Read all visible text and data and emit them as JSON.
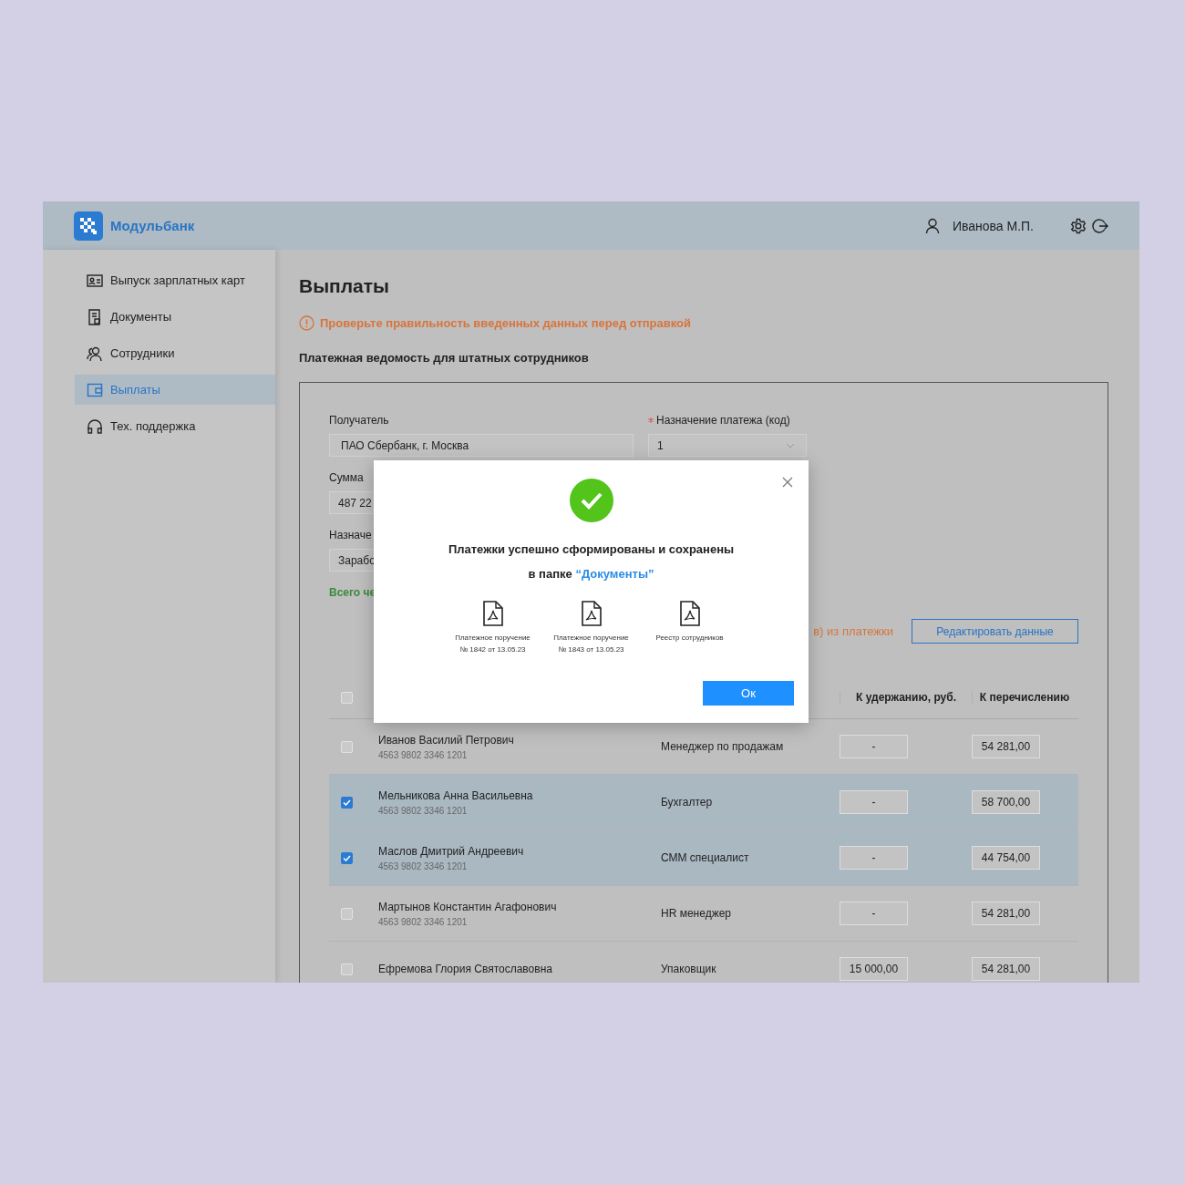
{
  "header": {
    "logo": "Модульбанк",
    "user": "Иванова М.П."
  },
  "sidebar": {
    "items": [
      {
        "label": "Выпуск зарплатных карт",
        "selected": false
      },
      {
        "label": "Документы",
        "selected": false
      },
      {
        "label": "Сотрудники",
        "selected": false
      },
      {
        "label": "Выплаты",
        "selected": true
      },
      {
        "label": "Тех. поддержка",
        "selected": false
      }
    ]
  },
  "page": {
    "title": "Выплаты",
    "warning": "Проверьте правильность введенных данных перед отправкой",
    "subtitle": "Платежная ведомость для штатных сотрудников"
  },
  "form": {
    "recipient_label": "Получатель",
    "recipient_value": "ПАО Сбербанк, г. Москва",
    "code_label": "Назначение платежа (код)",
    "code_required": true,
    "code_value": "1",
    "sum_label": "Сумма",
    "sum_value": "487 22",
    "purpose_label": "Назначе",
    "purpose_value": "Зарабо",
    "total": "Всего че",
    "excluded_note": "в) из платежки",
    "edit_button": "Редактировать данные"
  },
  "table": {
    "select_all_checked": false,
    "columns": [
      "К удержанию, руб.",
      "К перечислению"
    ],
    "rows": [
      {
        "name": "Иванов Василий Петрович",
        "card": "4563 9802 3346 1201",
        "position": "Менеджер по продажам",
        "deduction": "-",
        "transfer": "54 281,00",
        "selected": false
      },
      {
        "name": "Мельникова Анна Васильевна",
        "card": "4563 9802 3346 1201",
        "position": "Бухгалтер",
        "deduction": "-",
        "transfer": "58 700,00",
        "selected": true
      },
      {
        "name": "Маслов Дмитрий Андреевич",
        "card": "4563 9802 3346 1201",
        "position": "СММ специалист",
        "deduction": "-",
        "transfer": "44 754,00",
        "selected": true
      },
      {
        "name": "Мартынов Константин Агафонович",
        "card": "4563 9802 3346 1201",
        "position": "HR менеджер",
        "deduction": "-",
        "transfer": "54 281,00",
        "selected": false
      },
      {
        "name": "Ефремова Глория Святославовна",
        "position": "Упаковщик",
        "deduction": "15 000,00",
        "transfer": "54 281,00",
        "selected": false
      }
    ]
  },
  "modal": {
    "title": "Платежки успешно сформированы и сохранены",
    "folder_prefix": "в папке",
    "folder_link": "“Документы”",
    "files": [
      {
        "title": "Платежное поручение",
        "subtitle": "№ 1842 от 13.05.23"
      },
      {
        "title": "Платежное поручение",
        "subtitle": "№ 1843 от 13.05.23"
      },
      {
        "title": "Реестр сотрудников"
      }
    ],
    "ok_button": "Ок"
  }
}
